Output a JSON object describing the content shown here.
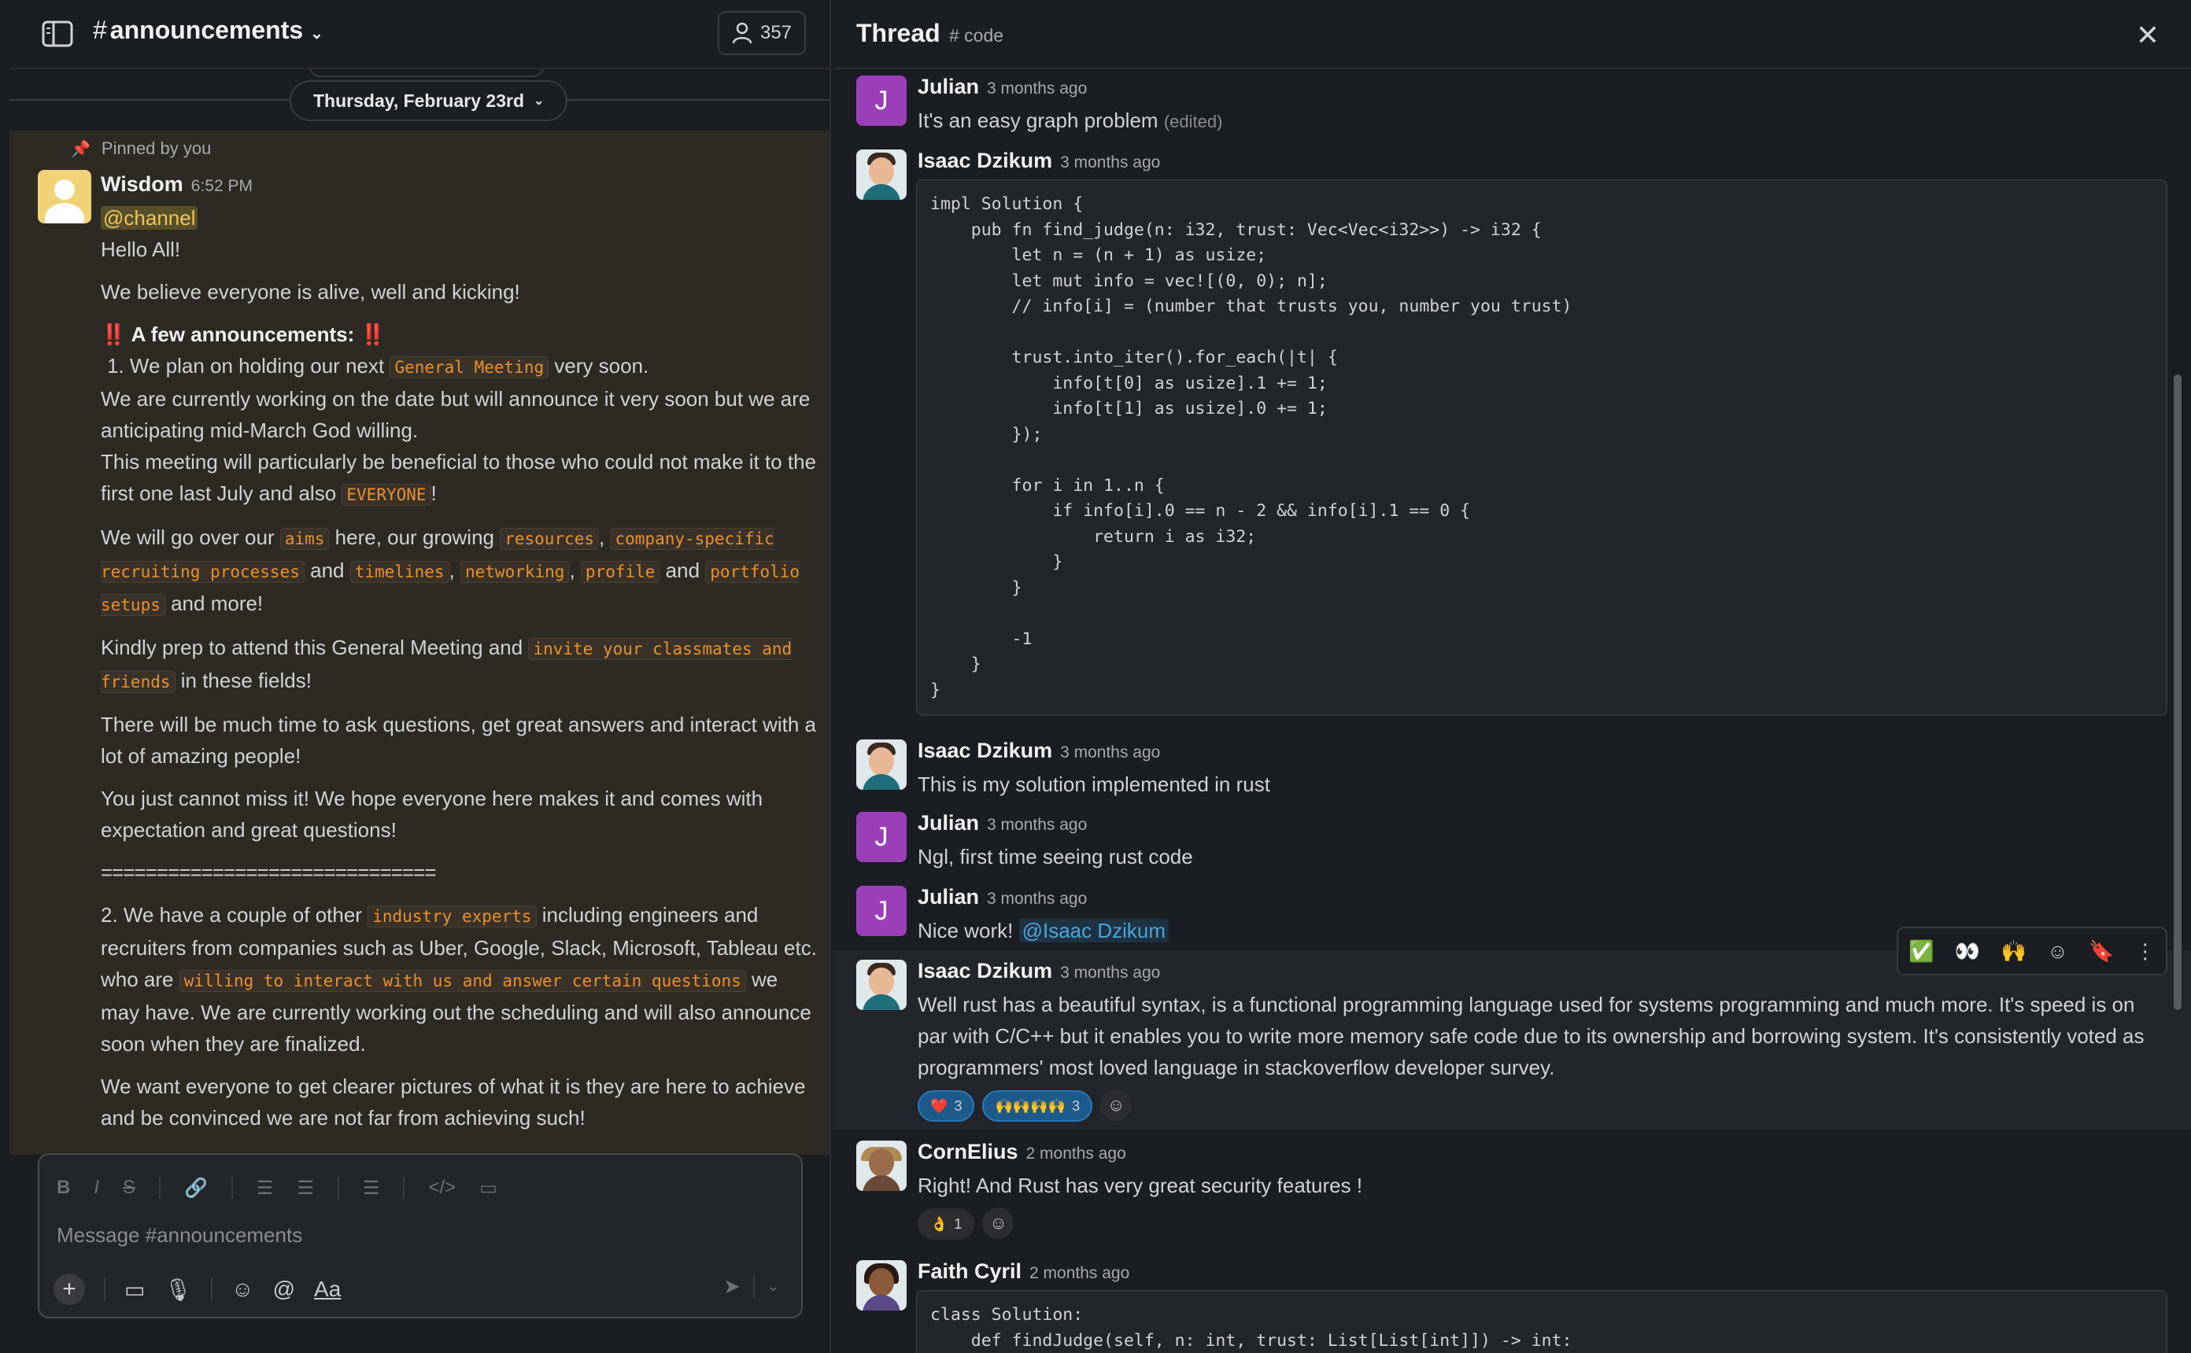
{
  "channel": {
    "hash": "#",
    "name": "announcements",
    "member_count": "357",
    "date_divider": "Thursday, February 23rd",
    "pinned_label": "Pinned by you",
    "message": {
      "author": "Wisdom",
      "time": "6:52 PM",
      "mention": "@channel",
      "greeting": "Hello All!",
      "line2": "We believe everyone is alive, well and kicking!",
      "bangs": "‼️",
      "heading": "A few announcements:",
      "item1_prefix": "1.   We plan on holding our next",
      "item1_code": "General Meeting",
      "item1_suffix": "very soon.",
      "p2a": "We are currently working on the date but will announce it very soon but we are anticipating mid-March God willing.",
      "p2b": "This meeting will particularly be beneficial to those who could not make it to the first one last July and also",
      "p2b_code": "EVERYONE",
      "p2b_end": "!",
      "p3_a": "We will go over our",
      "p3_aims": "aims",
      "p3_b": "here, our growing",
      "p3_resources": "resources",
      "p3_comma": ",",
      "p3_company": "company-specific recruiting processes",
      "p3_and": "and",
      "p3_timelines": "timelines",
      "p3_networking": "networking",
      "p3_profile": "profile",
      "p3_portfolio": "portfolio setups",
      "p3_end": "and more!",
      "p4_a": "Kindly prep to attend this General Meeting and",
      "p4_code": "invite your classmates and friends",
      "p4_end": "in these fields!",
      "p5": "There will be much time to ask questions, get great answers and interact with a lot of amazing people!",
      "p6": "You just cannot miss it! We hope everyone here makes it and comes with expectation and great questions!",
      "sep1": "==============================",
      "p7_a": "2. We have a couple of other",
      "p7_code": "industry experts",
      "p7_b": "including engineers and recruiters from companies such as Uber, Google, Slack, Microsoft, Tableau etc. who are",
      "p7_code2": "willing to interact with us and answer certain questions",
      "p7_c": "we may have. We are currently working out the scheduling and will also announce soon when they are finalized.",
      "p8": "We want everyone to get clearer pictures of what it is they are here to achieve and be convinced we are not far from achieving such!",
      "sep2": "==============================="
    },
    "composer": {
      "placeholder": "Message #announcements",
      "format_label": "Aa"
    }
  },
  "thread": {
    "title": "Thread",
    "channel": "# code",
    "messages": [
      {
        "author": "Julian",
        "time": "3 months ago",
        "initial": "J",
        "text": "It's an easy graph problem",
        "edited": "(edited)"
      },
      {
        "author": "Isaac Dzikum",
        "time": "3 months ago",
        "code": "impl Solution {\n    pub fn find_judge(n: i32, trust: Vec<Vec<i32>>) -> i32 {\n        let n = (n + 1) as usize;\n        let mut info = vec![(0, 0); n];\n        // info[i] = (number that trusts you, number you trust)\n\n        trust.into_iter().for_each(|t| {\n            info[t[0] as usize].1 += 1;\n            info[t[1] as usize].0 += 1;\n        });\n\n        for i in 1..n {\n            if info[i].0 == n - 2 && info[i].1 == 0 {\n                return i as i32;\n            }\n        }\n\n        -1\n    }\n}"
      },
      {
        "author": "Isaac Dzikum",
        "time": "3 months ago",
        "text": "This is my solution implemented in rust"
      },
      {
        "author": "Julian",
        "time": "3 months ago",
        "initial": "J",
        "text": "Ngl, first time seeing rust code"
      },
      {
        "author": "Julian",
        "time": "3 months ago",
        "initial": "J",
        "text": "Nice work!",
        "mention": "@Isaac Dzikum"
      },
      {
        "author": "Isaac Dzikum",
        "time": "3 months ago",
        "text": "Well rust has a beautiful syntax, is a functional programming language used for systems programming and much more. It's speed is on par with C/C++ but it enables you to write more memory safe code due to its ownership and borrowing system. It's consistently voted as programmers' most loved language in stackoverflow developer survey.",
        "reactions": [
          {
            "emoji": "❤️",
            "count": "3"
          },
          {
            "emoji": "🙌🙌🙌🙌",
            "count": "3"
          }
        ]
      },
      {
        "author": "CornElius",
        "time": "2 months ago",
        "text": "Right! And Rust has very great security features !",
        "reactions": [
          {
            "emoji": "👌",
            "count": "1"
          }
        ]
      },
      {
        "author": "Faith Cyril",
        "time": "2 months ago",
        "code": "class Solution:\n    def findJudge(self, n: int, trust: List[List[int]]) -> int:"
      }
    ]
  },
  "icons": {
    "sidebar_toggle": "sidebar-toggle-icon",
    "members": "person-icon",
    "close": "close-icon",
    "pin": "pin-icon"
  },
  "colors": {
    "background": "#1a1d21",
    "pinned_background": "#2d2a24",
    "inline_code": "#e8912d",
    "mention": "#4fa3d8",
    "julian_avatar": "#9b3fb8",
    "reaction_selected": "#1d5a8c"
  }
}
